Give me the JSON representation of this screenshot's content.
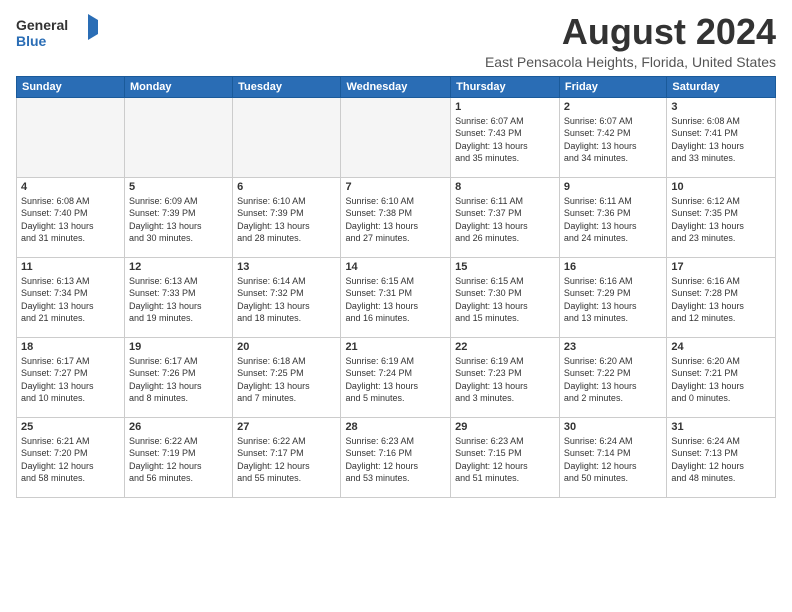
{
  "header": {
    "logo_general": "General",
    "logo_blue": "Blue",
    "month_title": "August 2024",
    "location": "East Pensacola Heights, Florida, United States"
  },
  "weekdays": [
    "Sunday",
    "Monday",
    "Tuesday",
    "Wednesday",
    "Thursday",
    "Friday",
    "Saturday"
  ],
  "weeks": [
    [
      {
        "day": "",
        "info": ""
      },
      {
        "day": "",
        "info": ""
      },
      {
        "day": "",
        "info": ""
      },
      {
        "day": "",
        "info": ""
      },
      {
        "day": "1",
        "info": "Sunrise: 6:07 AM\nSunset: 7:43 PM\nDaylight: 13 hours\nand 35 minutes."
      },
      {
        "day": "2",
        "info": "Sunrise: 6:07 AM\nSunset: 7:42 PM\nDaylight: 13 hours\nand 34 minutes."
      },
      {
        "day": "3",
        "info": "Sunrise: 6:08 AM\nSunset: 7:41 PM\nDaylight: 13 hours\nand 33 minutes."
      }
    ],
    [
      {
        "day": "4",
        "info": "Sunrise: 6:08 AM\nSunset: 7:40 PM\nDaylight: 13 hours\nand 31 minutes."
      },
      {
        "day": "5",
        "info": "Sunrise: 6:09 AM\nSunset: 7:39 PM\nDaylight: 13 hours\nand 30 minutes."
      },
      {
        "day": "6",
        "info": "Sunrise: 6:10 AM\nSunset: 7:39 PM\nDaylight: 13 hours\nand 28 minutes."
      },
      {
        "day": "7",
        "info": "Sunrise: 6:10 AM\nSunset: 7:38 PM\nDaylight: 13 hours\nand 27 minutes."
      },
      {
        "day": "8",
        "info": "Sunrise: 6:11 AM\nSunset: 7:37 PM\nDaylight: 13 hours\nand 26 minutes."
      },
      {
        "day": "9",
        "info": "Sunrise: 6:11 AM\nSunset: 7:36 PM\nDaylight: 13 hours\nand 24 minutes."
      },
      {
        "day": "10",
        "info": "Sunrise: 6:12 AM\nSunset: 7:35 PM\nDaylight: 13 hours\nand 23 minutes."
      }
    ],
    [
      {
        "day": "11",
        "info": "Sunrise: 6:13 AM\nSunset: 7:34 PM\nDaylight: 13 hours\nand 21 minutes."
      },
      {
        "day": "12",
        "info": "Sunrise: 6:13 AM\nSunset: 7:33 PM\nDaylight: 13 hours\nand 19 minutes."
      },
      {
        "day": "13",
        "info": "Sunrise: 6:14 AM\nSunset: 7:32 PM\nDaylight: 13 hours\nand 18 minutes."
      },
      {
        "day": "14",
        "info": "Sunrise: 6:15 AM\nSunset: 7:31 PM\nDaylight: 13 hours\nand 16 minutes."
      },
      {
        "day": "15",
        "info": "Sunrise: 6:15 AM\nSunset: 7:30 PM\nDaylight: 13 hours\nand 15 minutes."
      },
      {
        "day": "16",
        "info": "Sunrise: 6:16 AM\nSunset: 7:29 PM\nDaylight: 13 hours\nand 13 minutes."
      },
      {
        "day": "17",
        "info": "Sunrise: 6:16 AM\nSunset: 7:28 PM\nDaylight: 13 hours\nand 12 minutes."
      }
    ],
    [
      {
        "day": "18",
        "info": "Sunrise: 6:17 AM\nSunset: 7:27 PM\nDaylight: 13 hours\nand 10 minutes."
      },
      {
        "day": "19",
        "info": "Sunrise: 6:17 AM\nSunset: 7:26 PM\nDaylight: 13 hours\nand 8 minutes."
      },
      {
        "day": "20",
        "info": "Sunrise: 6:18 AM\nSunset: 7:25 PM\nDaylight: 13 hours\nand 7 minutes."
      },
      {
        "day": "21",
        "info": "Sunrise: 6:19 AM\nSunset: 7:24 PM\nDaylight: 13 hours\nand 5 minutes."
      },
      {
        "day": "22",
        "info": "Sunrise: 6:19 AM\nSunset: 7:23 PM\nDaylight: 13 hours\nand 3 minutes."
      },
      {
        "day": "23",
        "info": "Sunrise: 6:20 AM\nSunset: 7:22 PM\nDaylight: 13 hours\nand 2 minutes."
      },
      {
        "day": "24",
        "info": "Sunrise: 6:20 AM\nSunset: 7:21 PM\nDaylight: 13 hours\nand 0 minutes."
      }
    ],
    [
      {
        "day": "25",
        "info": "Sunrise: 6:21 AM\nSunset: 7:20 PM\nDaylight: 12 hours\nand 58 minutes."
      },
      {
        "day": "26",
        "info": "Sunrise: 6:22 AM\nSunset: 7:19 PM\nDaylight: 12 hours\nand 56 minutes."
      },
      {
        "day": "27",
        "info": "Sunrise: 6:22 AM\nSunset: 7:17 PM\nDaylight: 12 hours\nand 55 minutes."
      },
      {
        "day": "28",
        "info": "Sunrise: 6:23 AM\nSunset: 7:16 PM\nDaylight: 12 hours\nand 53 minutes."
      },
      {
        "day": "29",
        "info": "Sunrise: 6:23 AM\nSunset: 7:15 PM\nDaylight: 12 hours\nand 51 minutes."
      },
      {
        "day": "30",
        "info": "Sunrise: 6:24 AM\nSunset: 7:14 PM\nDaylight: 12 hours\nand 50 minutes."
      },
      {
        "day": "31",
        "info": "Sunrise: 6:24 AM\nSunset: 7:13 PM\nDaylight: 12 hours\nand 48 minutes."
      }
    ]
  ]
}
